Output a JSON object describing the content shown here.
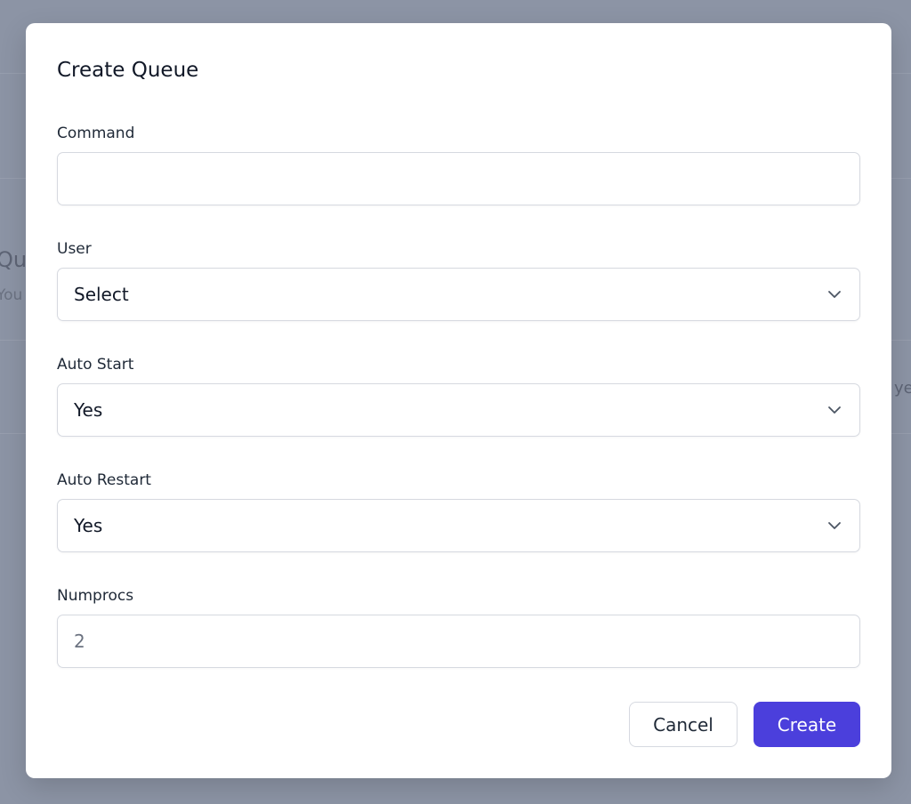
{
  "background": {
    "heading_fragment": "Qu",
    "subtitle_fragment": "You",
    "cell_fragment": "ye"
  },
  "modal": {
    "title": "Create Queue",
    "fields": [
      {
        "label": "Command",
        "value": ""
      },
      {
        "label": "User",
        "value": "Select"
      },
      {
        "label": "Auto Start",
        "value": "Yes"
      },
      {
        "label": "Auto Restart",
        "value": "Yes"
      },
      {
        "label": "Numprocs",
        "placeholder": "2"
      }
    ],
    "cancel_label": "Cancel",
    "create_label": "Create"
  },
  "colors": {
    "primary": "#4b3fdc",
    "overlay": "#8c94a5"
  }
}
